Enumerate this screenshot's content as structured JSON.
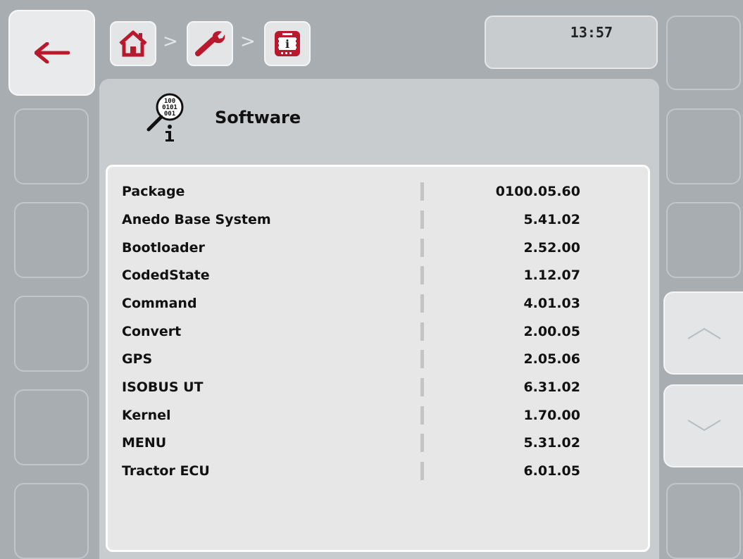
{
  "header": {
    "clock": "13:57",
    "breadcrumb": [
      "home-icon",
      "wrench-icon",
      "terminal-info-icon"
    ],
    "separator": ">"
  },
  "page": {
    "title": "Software",
    "title_icon": "software-info-icon"
  },
  "software": [
    {
      "name": "Package",
      "version": "0100.05.60"
    },
    {
      "name": "Anedo Base System",
      "version": "5.41.02"
    },
    {
      "name": "Bootloader",
      "version": "2.52.00"
    },
    {
      "name": "CodedState",
      "version": "1.12.07"
    },
    {
      "name": "Command",
      "version": "4.01.03"
    },
    {
      "name": "Convert",
      "version": "2.00.05"
    },
    {
      "name": "GPS",
      "version": "2.05.06"
    },
    {
      "name": "ISOBUS UT",
      "version": "6.31.02"
    },
    {
      "name": "Kernel",
      "version": "1.70.00"
    },
    {
      "name": "MENU",
      "version": "5.31.02"
    },
    {
      "name": "Tractor ECU",
      "version": "6.01.05"
    }
  ],
  "controls": {
    "back": "back-arrow-icon",
    "scroll_up": "chevron-up-icon",
    "scroll_down": "chevron-down-icon"
  },
  "colors": {
    "accent": "#c0172b",
    "background": "#a8adb2",
    "panel": "#c9cccf",
    "list_bg": "#e7e7e7"
  }
}
